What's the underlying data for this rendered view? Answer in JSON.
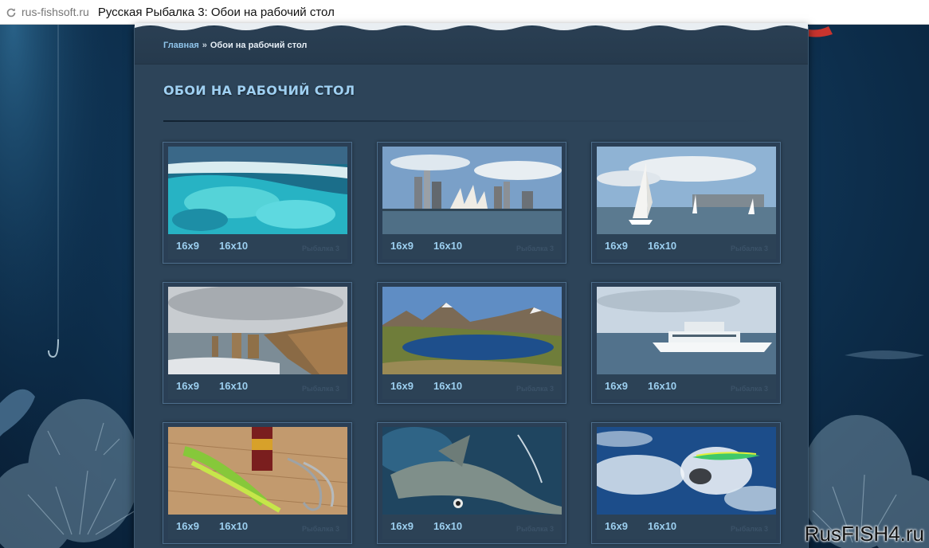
{
  "browser": {
    "url": "rus-fishsoft.ru",
    "page_title": "Русская Рыбалка 3: Обои на рабочий стол",
    "icons": [
      "reload-icon"
    ]
  },
  "breadcrumb": {
    "home": "Главная",
    "separator": "»",
    "current": "Обои на рабочий стол"
  },
  "page": {
    "heading": "ОБОИ НА РАБОЧИЙ СТОЛ"
  },
  "wallpapers": [
    {
      "subject": "reef",
      "res_a": "16x9",
      "res_b": "16x10"
    },
    {
      "subject": "opera-house",
      "res_a": "16x9",
      "res_b": "16x10"
    },
    {
      "subject": "sailboats",
      "res_a": "16x9",
      "res_b": "16x10"
    },
    {
      "subject": "cliffs",
      "res_a": "16x9",
      "res_b": "16x10"
    },
    {
      "subject": "mountain-lake",
      "res_a": "16x9",
      "res_b": "16x10"
    },
    {
      "subject": "yacht",
      "res_a": "16x9",
      "res_b": "16x10"
    },
    {
      "subject": "lures",
      "res_a": "16x9",
      "res_b": "16x10"
    },
    {
      "subject": "marlin",
      "res_a": "16x9",
      "res_b": "16x10"
    },
    {
      "subject": "lure-splash",
      "res_a": "16x9",
      "res_b": "16x10"
    }
  ],
  "card_logo": "Рыбалка 3",
  "watermark": "RusFISH4.ru",
  "colors": {
    "panel": "#2d4459",
    "link": "#9ccfef",
    "heading": "#9fd0f2",
    "background": "#0f3556"
  }
}
